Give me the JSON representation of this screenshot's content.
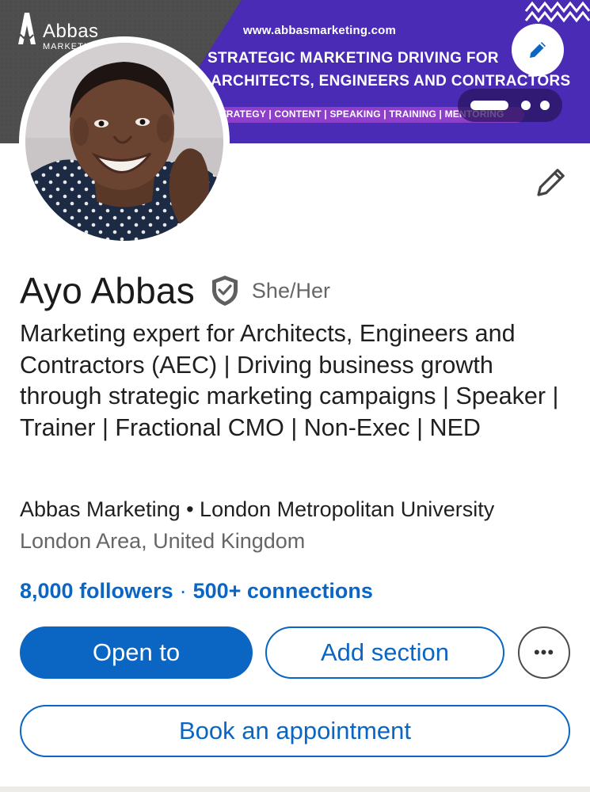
{
  "banner": {
    "logo_name": "Abbas",
    "logo_sub": "MARKETING",
    "url": "www.abbasmarketing.com",
    "headline_line1": "STRATEGIC MARKETING DRIVING FOR",
    "headline_line2": "ARCHITECTS, ENGINEERS AND CONTRACTORS",
    "tags": "STRATEGY | CONTENT | SPEAKING | TRAINING | MENTORING",
    "edit_icon": "pencil-icon",
    "carousel_current": 1,
    "carousel_total": 3
  },
  "profile": {
    "name": "Ayo Abbas",
    "verified_icon": "verified-shield-icon",
    "pronouns": "She/Her",
    "headline": "Marketing expert for Architects, Engineers and Contractors (AEC) | Driving business growth through strategic marketing campaigns | Speaker | Trainer | Fractional CMO | Non-Exec | NED",
    "org": "Abbas Marketing • London Metropolitan University",
    "location": "London Area, United Kingdom",
    "followers": "8,000 followers",
    "separator": "·",
    "connections": "500+ connections"
  },
  "actions": {
    "open_to": "Open to",
    "add_section": "Add section",
    "more": "•••",
    "book": "Book an appointment"
  },
  "colors": {
    "accent": "#0a66c2",
    "banner_purple": "#4a2bb5",
    "banner_magenta": "#8e3fc9"
  }
}
